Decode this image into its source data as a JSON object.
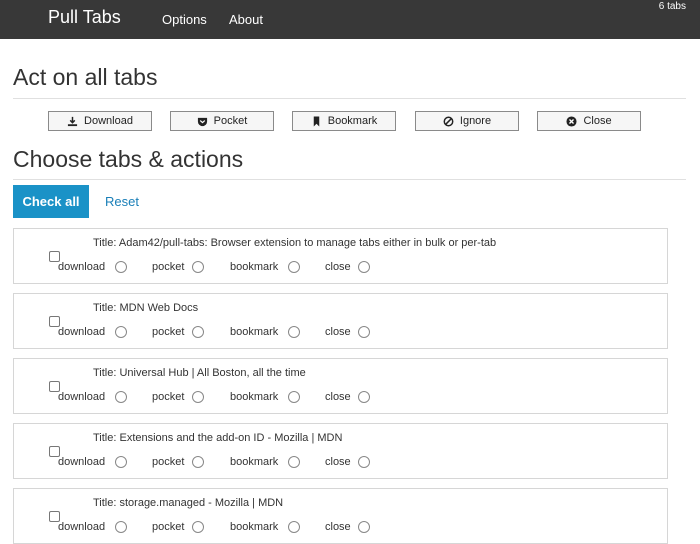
{
  "header": {
    "brand": "Pull Tabs",
    "nav": [
      "Options",
      "About"
    ],
    "tab_count": "6 tabs"
  },
  "act_section": {
    "heading": "Act on all tabs",
    "buttons": [
      {
        "label": "Download",
        "icon": "download-icon"
      },
      {
        "label": "Pocket",
        "icon": "pocket-icon"
      },
      {
        "label": "Bookmark",
        "icon": "bookmark-icon"
      },
      {
        "label": "Ignore",
        "icon": "ignore-icon"
      },
      {
        "label": "Close",
        "icon": "close-circle-icon"
      }
    ]
  },
  "choose_section": {
    "heading": "Choose tabs & actions",
    "check_all": "Check all",
    "reset": "Reset"
  },
  "options": [
    "download",
    "pocket",
    "bookmark",
    "close"
  ],
  "tabs": [
    {
      "title": "Title: Adam42/pull-tabs: Browser extension to manage tabs either in bulk or per-tab"
    },
    {
      "title": "Title: MDN Web Docs"
    },
    {
      "title": "Title: Universal Hub | All Boston, all the time"
    },
    {
      "title": "Title: Extensions and the add-on ID - Mozilla | MDN"
    },
    {
      "title": "Title: storage.managed - Mozilla | MDN"
    }
  ],
  "colors": {
    "topbar": "#383838",
    "accent": "#1a92c7",
    "link": "#1a7fb8"
  }
}
